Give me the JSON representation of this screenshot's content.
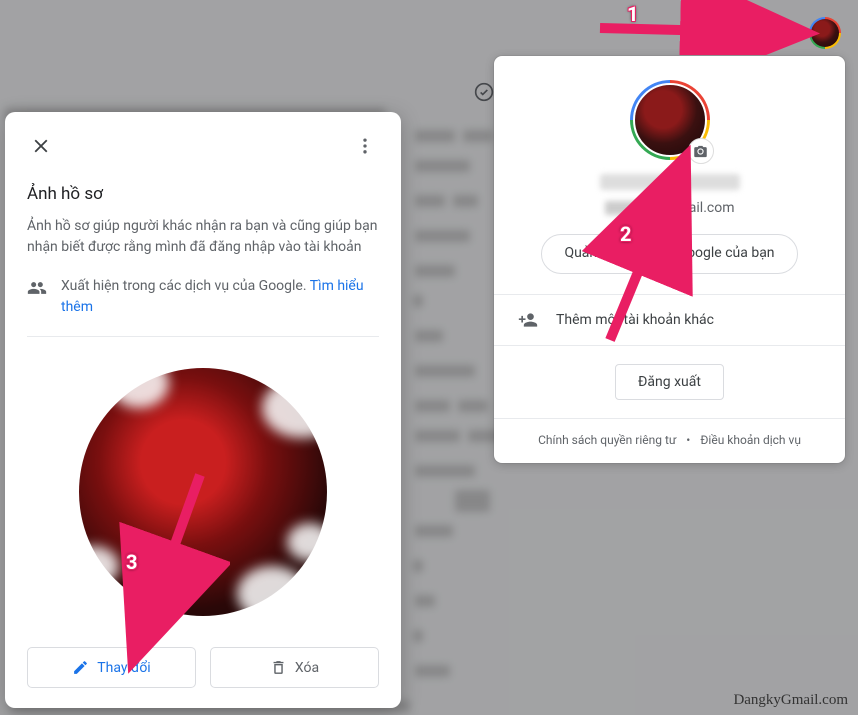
{
  "popover": {
    "email_suffix": "mail.com",
    "manage_label": "Quản lý Tài khoản Google của bạn",
    "add_account_label": "Thêm một tài khoản khác",
    "signout_label": "Đăng xuất",
    "privacy_label": "Chính sách quyền riêng tư",
    "terms_label": "Điều khoản dịch vụ",
    "footer_dot": "•"
  },
  "dialog": {
    "title": "Ảnh hồ sơ",
    "description": "Ảnh hồ sơ giúp người khác nhận ra bạn và cũng giúp bạn nhận biết được rằng mình đã đăng nhập vào tài khoản",
    "visibility_text": "Xuất hiện trong các dịch vụ của Google. ",
    "learn_more": "Tìm hiểu thêm",
    "change_label": "Thay đổi",
    "remove_label": "Xóa"
  },
  "annotations": {
    "num1": "1",
    "num2": "2",
    "num3": "3"
  },
  "watermark": "DangkyGmail.com"
}
